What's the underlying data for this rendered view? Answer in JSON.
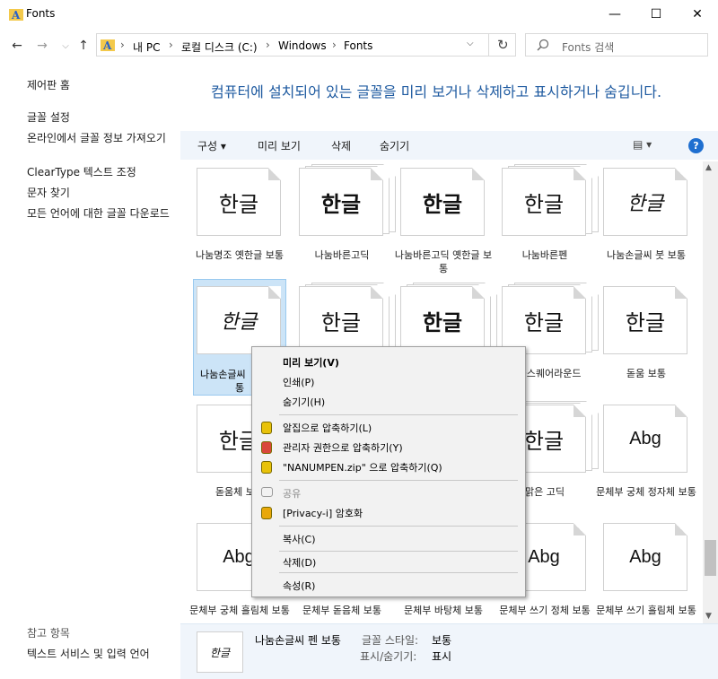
{
  "window": {
    "title": "Fonts",
    "minimize": "—",
    "maximize": "☐",
    "close": "✕"
  },
  "nav": {
    "back": "←",
    "forward": "→",
    "recent": "⌵",
    "up": "↑",
    "breadcrumb": [
      "내 PC",
      "로컬 디스크 (C:)",
      "Windows",
      "Fonts"
    ],
    "sep": "›",
    "dropdown": "⌵",
    "refresh": "↻",
    "search_placeholder": "Fonts 검색"
  },
  "left_pane": {
    "home": "제어판 홈",
    "links": [
      "글꼴 설정",
      "온라인에서 글꼴 정보 가져오기",
      "ClearType 텍스트 조정",
      "문자 찾기",
      "모든 언어에 대한 글꼴 다운로드"
    ],
    "see_also_title": "참고 항목",
    "see_also": [
      "텍스트 서비스 및 입력 언어"
    ]
  },
  "heading": "컴퓨터에 설치되어 있는 글꼴을 미리 보거나 삭제하고 표시하거나 숨깁니다.",
  "toolbar": {
    "organize": "구성 ▾",
    "preview": "미리 보기",
    "delete": "삭제",
    "hide": "숨기기",
    "view_icon": "▤ ▾",
    "help": "?"
  },
  "fonts": [
    {
      "name": "나눔명조 옛한글 보통",
      "sample": "한글",
      "style": "serif",
      "stack": false
    },
    {
      "name": "나눔바른고딕",
      "sample": "한글",
      "style": "bold",
      "stack": true
    },
    {
      "name": "나눔바른고딕 옛한글 보통",
      "sample": "한글",
      "style": "bold",
      "stack": false
    },
    {
      "name": "나눔바른펜",
      "sample": "한글",
      "style": "sans",
      "stack": true
    },
    {
      "name": "나눔손글씨 붓 보통",
      "sample": "한글",
      "style": "script",
      "stack": false
    },
    {
      "name": "나눔손글씨 펜 보통",
      "sample": "한글",
      "style": "script",
      "stack": false
    },
    {
      "name": "",
      "sample": "한글",
      "style": "sans",
      "stack": true
    },
    {
      "name": "",
      "sample": "한글",
      "style": "bold",
      "stack": true
    },
    {
      "name": "나눔스퀘어라운드",
      "sample": "한글",
      "style": "sans",
      "stack": true
    },
    {
      "name": "돋움 보통",
      "sample": "한글",
      "style": "sans",
      "stack": false
    },
    {
      "name": "돋움체 보통",
      "sample": "한글",
      "style": "sans",
      "stack": false
    },
    {
      "name": "",
      "sample": "",
      "style": "sans",
      "stack": true
    },
    {
      "name": "",
      "sample": "",
      "style": "sans",
      "stack": true
    },
    {
      "name": "맑은 고딕",
      "sample": "한글",
      "style": "sans",
      "stack": true
    },
    {
      "name": "문체부 궁체 정자체 보통",
      "sample": "Abg",
      "style": "latin",
      "stack": false
    },
    {
      "name": "문체부 궁체 흘림체 보통",
      "sample": "Abg",
      "style": "latin",
      "stack": false
    },
    {
      "name": "문체부 돋음체 보통",
      "sample": "",
      "style": "latin",
      "stack": false
    },
    {
      "name": "문체부 바탕체 보통",
      "sample": "",
      "style": "latin",
      "stack": false
    },
    {
      "name": "문체부 쓰기 정체 보통",
      "sample": "Abg",
      "style": "latin",
      "stack": false
    },
    {
      "name": "문체부 쓰기 흘림체 보통",
      "sample": "Abg",
      "style": "latin",
      "stack": false
    }
  ],
  "selected_label_1": "나눔손글씨",
  "selected_label_2": "통",
  "context_menu": {
    "items": [
      {
        "label": "미리 보기(V)",
        "bold": true,
        "icon": ""
      },
      {
        "label": "인쇄(P)",
        "bold": false,
        "icon": ""
      },
      {
        "label": "숨기기(H)",
        "bold": false,
        "icon": ""
      },
      {
        "label": "알집으로 압축하기(L)",
        "bold": false,
        "icon": "alzip-icon"
      },
      {
        "label": "관리자 권한으로 압축하기(Y)",
        "bold": false,
        "icon": "admin-zip-icon"
      },
      {
        "label": "\"NANUMPEN.zip\" 으로 압축하기(Q)",
        "bold": false,
        "icon": "alzip-icon"
      },
      {
        "label": "공유",
        "bold": false,
        "icon": "share-icon",
        "disabled": true
      },
      {
        "label": "[Privacy-i] 암호화",
        "bold": false,
        "icon": "lock-icon"
      },
      {
        "label": "복사(C)",
        "bold": false,
        "icon": ""
      },
      {
        "label": "삭제(D)",
        "bold": false,
        "icon": ""
      },
      {
        "label": "속성(R)",
        "bold": false,
        "icon": ""
      }
    ]
  },
  "details": {
    "name": "나눔손글씨 펜 보통",
    "style_label": "글꼴 스타일:",
    "style_value": "보통",
    "visibility_label": "표시/숨기기:",
    "visibility_value": "표시",
    "thumb_sample": "한글"
  },
  "colors": {
    "accent": "#1e5aa0",
    "selection": "#cce4f7",
    "toolbar_bg": "#f0f5fb"
  }
}
